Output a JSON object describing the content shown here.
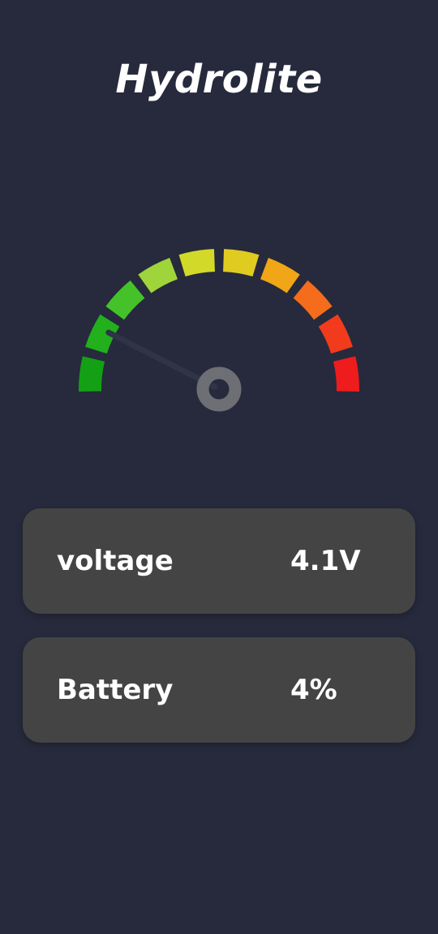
{
  "app": {
    "title": "Hydrolite"
  },
  "gauge": {
    "level": 0.13,
    "segment_colors": [
      "#14a014",
      "#22b01c",
      "#45c22a",
      "#9fd43a",
      "#d2d928",
      "#e0cc20",
      "#f0a616",
      "#f46c1c",
      "#f23b1c",
      "#ee1c1c"
    ],
    "needle_color": "#2f3446",
    "hub_color": "#6e6f75"
  },
  "readings": {
    "voltage": {
      "label": "voltage",
      "value": "4.1V"
    },
    "battery": {
      "label": "Battery",
      "value": "4%"
    }
  }
}
